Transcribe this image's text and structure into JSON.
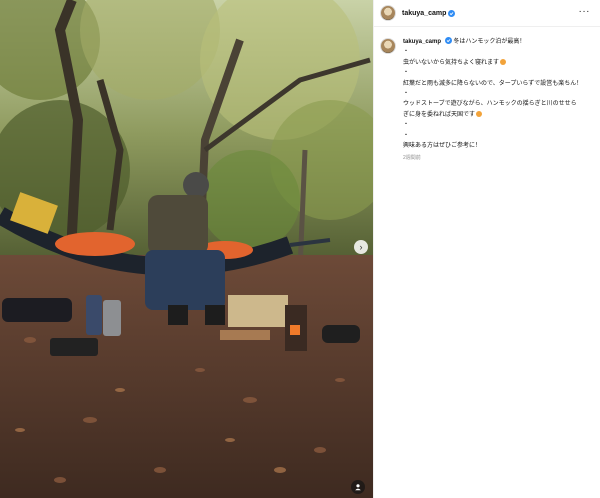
{
  "post": {
    "username": "takuya_camp",
    "verified": true,
    "more_icon": "ellipsis-icon",
    "caption": {
      "lines": [
        {
          "text": "冬はハンモック泊が最高！",
          "emoji": false
        },
        {
          "text": "・",
          "emoji": false
        },
        {
          "text": "虫がいないから気持ちよく寝れます",
          "emoji": true
        },
        {
          "text": "・",
          "emoji": false
        },
        {
          "text": "紅葉だと雨も滅多に降らないので、タープいらずで設営も楽ちん！",
          "emoji": false
        },
        {
          "text": "・",
          "emoji": false
        },
        {
          "text": "ウッドストーブで遊びながら、ハンモックの揺らぎと川のせせら",
          "emoji": false
        },
        {
          "text": "ぎに身を委ねれば天国です",
          "emoji": true
        },
        {
          "text": "・",
          "emoji": false
        },
        {
          "text": "・",
          "emoji": false
        },
        {
          "text": "興味ある方はぜひご参考に！",
          "emoji": false
        }
      ],
      "timestamp": "2週間前"
    },
    "photo": {
      "description_icon": "photo",
      "carousel_next_icon": "chevron-right-icon",
      "media_badge_icon": "user-tag-icon"
    }
  }
}
